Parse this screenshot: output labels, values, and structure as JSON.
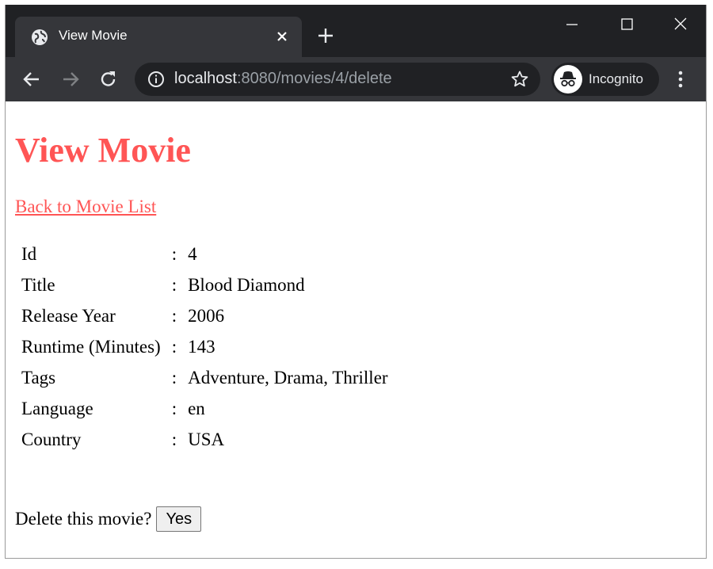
{
  "browser": {
    "tab_title": "View Movie",
    "url_host": "localhost",
    "url_rest": ":8080/movies/4/delete",
    "profile_label": "Incognito"
  },
  "page": {
    "heading": "View Movie",
    "back_link": "Back to Movie List",
    "separator": ":",
    "fields": [
      {
        "label": "Id",
        "value": "4"
      },
      {
        "label": "Title",
        "value": "Blood Diamond"
      },
      {
        "label": "Release Year",
        "value": "2006"
      },
      {
        "label": "Runtime (Minutes)",
        "value": "143"
      },
      {
        "label": "Tags",
        "value": "Adventure, Drama, Thriller"
      },
      {
        "label": "Language",
        "value": "en"
      },
      {
        "label": "Country",
        "value": "USA"
      }
    ],
    "confirm_text": "Delete this movie?",
    "confirm_button": "Yes"
  },
  "colors": {
    "accent": "#ff5555",
    "titlebar": "#202124",
    "toolbar": "#35363a"
  }
}
